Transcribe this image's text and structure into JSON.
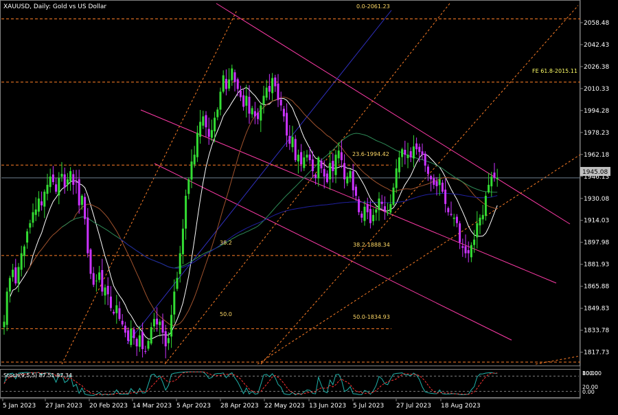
{
  "chart_title": "XAUUSD, Daily:  Gold vs US Dollar",
  "stoch_title": "Stoch(9,5,5) 87.51 87.34",
  "current_price_label": "1945.08",
  "fe_label": "FE 61.8-2015.11",
  "fib_labels": {
    "fib0": "0.0-2061.23",
    "fib236": "23.6-1994.42",
    "fib382_left": "38.2",
    "fib382_right": "38.2-1888.34",
    "fib50_left": "50.0",
    "fib50_right": "50.0-1834.93"
  },
  "stoch_scale": [
    "80.00",
    "20.00",
    "0.00"
  ],
  "stoch_scale_top": "100.00",
  "chart_data": {
    "type": "candlestick",
    "symbol": "XAUUSD",
    "timeframe": "Daily",
    "ylim": [
      1809.0,
      2074.0
    ],
    "price_ticks": [
      2058.48,
      2042.43,
      2026.38,
      2010.33,
      1994.28,
      1978.23,
      1962.18,
      1946.13,
      1930.08,
      1914.03,
      1897.98,
      1881.93,
      1865.88,
      1849.83,
      1833.78,
      1817.73
    ],
    "date_ticks": [
      "5 Jan 2023",
      "27 Jan 2023",
      "20 Feb 2023",
      "14 Mar 2023",
      "5 Apr 2023",
      "28 Apr 2023",
      "22 May 2023",
      "13 Jun 2023",
      "5 Jul 2023",
      "27 Jul 2023",
      "18 Aug 2023"
    ],
    "bar_count": 170,
    "last_price": 1945.08,
    "fib_levels": {
      "0.0": 2061.23,
      "23.6": 1954.42,
      "38.2": 1888.34,
      "50.0": 1834.93,
      "FE 61.8": 2015.11
    },
    "closes": [
      1840,
      1862,
      1872,
      1878,
      1868,
      1880,
      1890,
      1895,
      1906,
      1912,
      1920,
      1922,
      1930,
      1925,
      1935,
      1940,
      1946,
      1942,
      1935,
      1945,
      1948,
      1938,
      1944,
      1950,
      1940,
      1942,
      1925,
      1932,
      1915,
      1890,
      1875,
      1867,
      1870,
      1876,
      1862,
      1865,
      1860,
      1850,
      1846,
      1852,
      1842,
      1838,
      1832,
      1826,
      1835,
      1828,
      1822,
      1830,
      1820,
      1818,
      1826,
      1836,
      1842,
      1838,
      1840,
      1832,
      1822,
      1828,
      1845,
      1862,
      1872,
      1890,
      1908,
      1932,
      1944,
      1957,
      1962,
      1978,
      1986,
      1990,
      1982,
      1975,
      1980,
      1989,
      1995,
      2008,
      2020,
      2010,
      2017,
      2025,
      2015,
      2010,
      2004,
      1997,
      2005,
      1992,
      1996,
      1990,
      1988,
      1998,
      2005,
      2011,
      2008,
      2018,
      2012,
      2002,
      1998,
      1990,
      1976,
      1970,
      1975,
      1958,
      1962,
      1955,
      1960,
      1962,
      1958,
      1950,
      1945,
      1960,
      1952,
      1946,
      1942,
      1956,
      1950,
      1962,
      1965,
      1958,
      1944,
      1946,
      1950,
      1936,
      1932,
      1920,
      1916,
      1924,
      1920,
      1912,
      1918,
      1922,
      1930,
      1926,
      1921,
      1920,
      1926,
      1938,
      1952,
      1960,
      1966,
      1962,
      1962,
      1960,
      1968,
      1966,
      1964,
      1962,
      1954,
      1948,
      1944,
      1940,
      1939,
      1944,
      1935,
      1926,
      1920,
      1918,
      1916,
      1912,
      1898,
      1894,
      1890,
      1890,
      1896,
      1900,
      1912,
      1916,
      1918,
      1932,
      1940,
      1946,
      1945,
      1945.08
    ]
  }
}
